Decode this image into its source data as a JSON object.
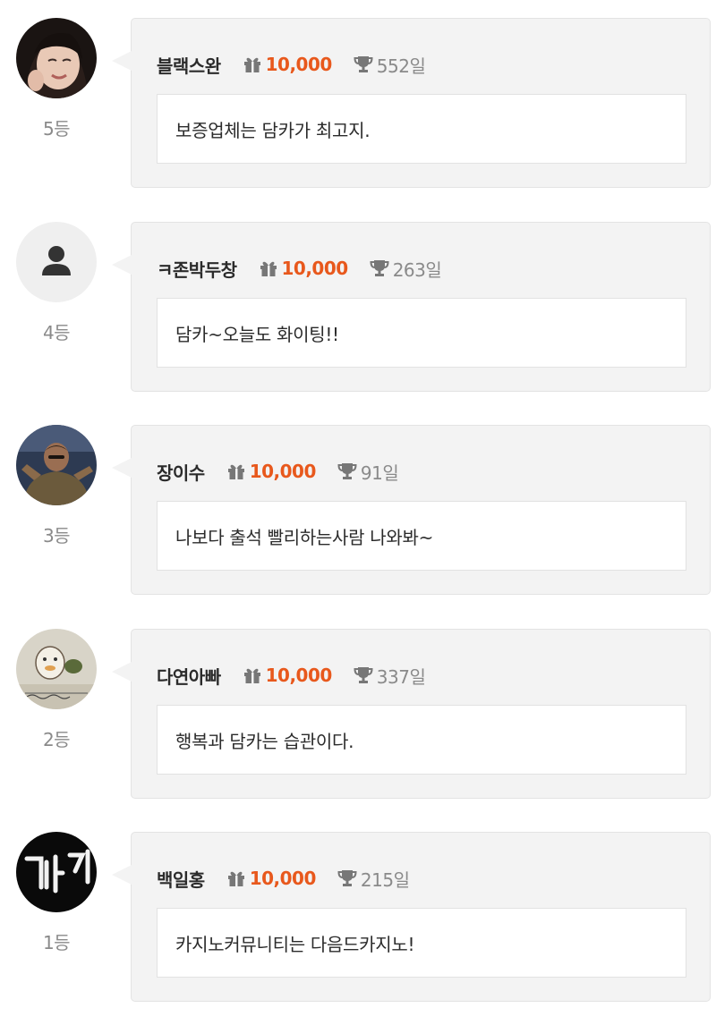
{
  "entries": [
    {
      "rank": "5등",
      "nickname": "블랙스완",
      "points": "10,000",
      "days": "552일",
      "message": "보증업체는 담카가 최고지.",
      "avatar": "woman-photo-avatar"
    },
    {
      "rank": "4등",
      "nickname": "ㅋ존박두창",
      "points": "10,000",
      "days": "263일",
      "message": "담카~오늘도 화이팅!!",
      "avatar": "default-user-icon"
    },
    {
      "rank": "3등",
      "nickname": "장이수",
      "points": "10,000",
      "days": "91일",
      "message": "나보다 출석 빨리하는사람 나와봐~",
      "avatar": "man-photo-avatar"
    },
    {
      "rank": "2등",
      "nickname": "다연아빠",
      "points": "10,000",
      "days": "337일",
      "message": "행복과 담카는 습관이다.",
      "avatar": "cartoon-avatar"
    },
    {
      "rank": "1등",
      "nickname": "백일홍",
      "points": "10,000",
      "days": "215일",
      "message": "카지노커뮤니티는 다음드카지노!",
      "avatar": "neon-sign-avatar"
    }
  ],
  "colors": {
    "points": "#e8581c",
    "card_bg": "#f3f3f3",
    "muted_text": "#8a8a8a",
    "strong_text": "#2b2b2b"
  },
  "icons": {
    "gift": "gift-icon",
    "trophy": "trophy-icon"
  }
}
